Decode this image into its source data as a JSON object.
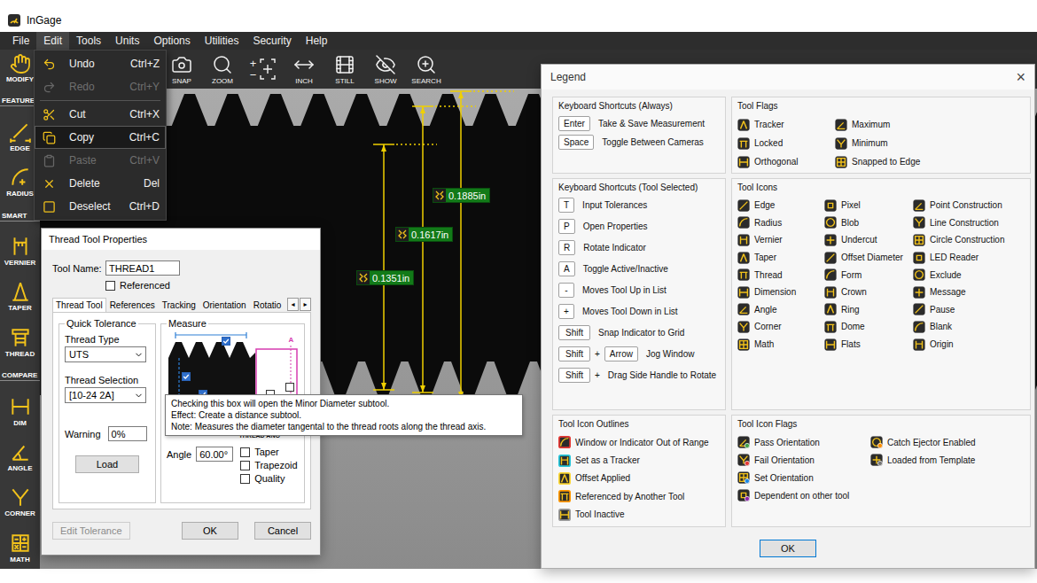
{
  "window": {
    "title": "InGage"
  },
  "menu_bar": [
    {
      "label": "File",
      "selected": false
    },
    {
      "label": "Edit",
      "selected": true
    },
    {
      "label": "Tools",
      "selected": false
    },
    {
      "label": "Units",
      "selected": false
    },
    {
      "label": "Options",
      "selected": false
    },
    {
      "label": "Utilities",
      "selected": false
    },
    {
      "label": "Security",
      "selected": false
    },
    {
      "label": "Help",
      "selected": false
    }
  ],
  "toolbar": [
    {
      "kind": "button",
      "label": "SNAP"
    },
    {
      "kind": "button",
      "label": "ZOOM"
    },
    {
      "kind": "zoom-steps",
      "symbols": [
        "+",
        "−"
      ]
    },
    {
      "kind": "button",
      "label": "INCH"
    },
    {
      "kind": "button",
      "label": "STILL"
    },
    {
      "kind": "button",
      "label": "SHOW"
    },
    {
      "kind": "button",
      "label": "SEARCH"
    }
  ],
  "sidebar": [
    {
      "kind": "tool",
      "label": "MODIFY"
    },
    {
      "kind": "section",
      "label": "FEATURE"
    },
    {
      "kind": "tool",
      "label": "EDGE"
    },
    {
      "kind": "tool",
      "label": "RADIUS"
    },
    {
      "kind": "section",
      "label": "SMART"
    },
    {
      "kind": "tool",
      "label": "VERNIER"
    },
    {
      "kind": "tool",
      "label": "TAPER"
    },
    {
      "kind": "tool",
      "label": "THREAD"
    },
    {
      "kind": "section",
      "label": "COMPARE"
    },
    {
      "kind": "tool",
      "label": "DIM"
    },
    {
      "kind": "tool",
      "label": "ANGLE"
    },
    {
      "kind": "tool",
      "label": "CORNER"
    },
    {
      "kind": "tool",
      "label": "MATH"
    }
  ],
  "camera": {
    "measurements": [
      {
        "value": "0.1885in"
      },
      {
        "value": "0.1617in"
      },
      {
        "value": "0.1351in"
      }
    ]
  },
  "edit_menu": [
    {
      "label": "Undo",
      "shortcut": "Ctrl+Z",
      "disabled": false,
      "selected": false,
      "divider_before": false
    },
    {
      "label": "Redo",
      "shortcut": "Ctrl+Y",
      "disabled": true,
      "selected": false,
      "divider_before": false
    },
    {
      "label": "Cut",
      "shortcut": "Ctrl+X",
      "disabled": false,
      "selected": false,
      "divider_before": true
    },
    {
      "label": "Copy",
      "shortcut": "Ctrl+C",
      "disabled": false,
      "selected": true,
      "divider_before": false
    },
    {
      "label": "Paste",
      "shortcut": "Ctrl+V",
      "disabled": true,
      "selected": false,
      "divider_before": false
    },
    {
      "label": "Delete",
      "shortcut": "Del",
      "disabled": false,
      "selected": false,
      "divider_before": false
    },
    {
      "label": "Deselect",
      "shortcut": "Ctrl+D",
      "disabled": false,
      "selected": false,
      "divider_before": false
    }
  ],
  "thread_dialog": {
    "title": "Thread Tool Properties",
    "tool_name_label": "Tool Name:",
    "tool_name": "THREAD1",
    "referenced": {
      "label": "Referenced",
      "checked": false
    },
    "tabs": [
      {
        "label": "Thread Tool",
        "selected": true
      },
      {
        "label": "References",
        "selected": false
      },
      {
        "label": "Tracking",
        "selected": false
      },
      {
        "label": "Orientation",
        "selected": false
      },
      {
        "label": "Rotatio",
        "selected": false
      }
    ],
    "tab_scroll": [
      "◂",
      "▸"
    ],
    "quick_tolerance": {
      "title": "Quick Tolerance",
      "thread_type_label": "Thread Type",
      "thread_type": "UTS",
      "thread_selection_label": "Thread Selection",
      "thread_selection": "[10-24 2A]",
      "warning_label": "Warning",
      "warning": "0%",
      "load": "Load"
    },
    "measure": {
      "title": "Measure",
      "diagram_labels": [
        "A",
        "A",
        "THREAD ANG"
      ],
      "subtools": [
        {
          "checked": true
        },
        {
          "checked": true
        },
        {
          "checked": true
        },
        {
          "checked": false
        },
        {
          "checked": false
        }
      ],
      "angle_label": "Angle",
      "angle": "60.00°",
      "options": [
        {
          "label": "Taper",
          "checked": false
        },
        {
          "label": "Trapezoid",
          "checked": false
        },
        {
          "label": "Quality",
          "checked": false
        }
      ]
    },
    "buttons": [
      {
        "label": "Edit Tolerance",
        "disabled": true
      },
      {
        "label": "OK",
        "disabled": false
      },
      {
        "label": "Cancel",
        "disabled": false
      }
    ]
  },
  "tooltip": {
    "lines": [
      "Checking this box will open the Minor Diameter subtool.",
      "Effect: Create a distance subtool.",
      "Note: Measures the diameter tangental to the thread roots along the thread axis."
    ]
  },
  "legend": {
    "title": "Legend",
    "close": "×",
    "shortcuts_always": {
      "title": "Keyboard Shortcuts (Always)",
      "rows": [
        {
          "keys": [
            {
              "kind": "key",
              "label": "Enter"
            }
          ],
          "description": "Take & Save Measurement"
        },
        {
          "keys": [
            {
              "kind": "key",
              "label": "Space"
            }
          ],
          "description": "Toggle Between Cameras"
        }
      ]
    },
    "shortcuts_tool": {
      "title": "Keyboard Shortcuts (Tool Selected)",
      "rows": [
        {
          "keys": [
            {
              "kind": "key",
              "label": "T"
            }
          ],
          "description": "Input Tolerances"
        },
        {
          "keys": [
            {
              "kind": "key",
              "label": "P"
            }
          ],
          "description": "Open Properties"
        },
        {
          "keys": [
            {
              "kind": "key",
              "label": "R"
            }
          ],
          "description": "Rotate Indicator"
        },
        {
          "keys": [
            {
              "kind": "key",
              "label": "A"
            }
          ],
          "description": "Toggle Active/Inactive"
        },
        {
          "keys": [
            {
              "kind": "key",
              "label": "-"
            }
          ],
          "description": "Moves Tool Up in List"
        },
        {
          "keys": [
            {
              "kind": "key",
              "label": "+"
            }
          ],
          "description": "Moves Tool Down in List"
        },
        {
          "keys": [
            {
              "kind": "key",
              "label": "Shift"
            }
          ],
          "description": "Snap Indicator to Grid"
        },
        {
          "keys": [
            {
              "kind": "key",
              "label": "Shift"
            },
            {
              "kind": "plus",
              "label": "+"
            },
            {
              "kind": "key",
              "label": "Arrow"
            }
          ],
          "description": "Jog Window"
        },
        {
          "keys": [
            {
              "kind": "key",
              "label": "Shift"
            },
            {
              "kind": "plus",
              "label": "+"
            }
          ],
          "description": "Drag Side Handle to Rotate"
        }
      ]
    },
    "tool_flags": {
      "title": "Tool Flags",
      "items": [
        {
          "label": "Tracker"
        },
        {
          "label": "Locked"
        },
        {
          "label": "Orthogonal"
        },
        {
          "label": "Maximum"
        },
        {
          "label": "Minimum"
        },
        {
          "label": "Snapped to Edge"
        }
      ]
    },
    "tool_icons": {
      "title": "Tool Icons",
      "items": [
        {
          "label": "Edge"
        },
        {
          "label": "Radius"
        },
        {
          "label": "Vernier"
        },
        {
          "label": "Taper"
        },
        {
          "label": "Thread"
        },
        {
          "label": "Dimension"
        },
        {
          "label": "Angle"
        },
        {
          "label": "Corner"
        },
        {
          "label": "Math"
        },
        {
          "label": "Pixel"
        },
        {
          "label": "Blob"
        },
        {
          "label": "Undercut"
        },
        {
          "label": "Offset Diameter"
        },
        {
          "label": "Form"
        },
        {
          "label": "Crown"
        },
        {
          "label": "Ring"
        },
        {
          "label": "Dome"
        },
        {
          "label": "Flats"
        },
        {
          "label": "Point Construction"
        },
        {
          "label": "Line Construction"
        },
        {
          "label": "Circle Construction"
        },
        {
          "label": "LED Reader"
        },
        {
          "label": "Exclude"
        },
        {
          "label": "Message"
        },
        {
          "label": "Pause"
        },
        {
          "label": "Blank"
        },
        {
          "label": "Origin"
        }
      ]
    },
    "icon_outlines": {
      "title": "Tool Icon Outlines",
      "items": [
        {
          "label": "Window or Indicator Out of Range",
          "color": "#e53935"
        },
        {
          "label": "Set as a Tracker",
          "color": "#26c6da"
        },
        {
          "label": "Offset Applied",
          "color": "#fdd835"
        },
        {
          "label": "Referenced by Another Tool",
          "color": "#ff9800"
        },
        {
          "label": "Tool Inactive",
          "color": "#9e9e9e"
        }
      ]
    },
    "icon_flags": {
      "title": "Tool Icon Flags",
      "items": [
        {
          "label": "Pass Orientation",
          "color": "#43a047"
        },
        {
          "label": "Fail Orientation",
          "color": "#e53935"
        },
        {
          "label": "Set Orientation",
          "color": "#1e88e5"
        },
        {
          "label": "Dependent on other tool",
          "color": "#8e24aa"
        },
        {
          "label": "Catch Ejector Enabled",
          "color": "#fb8c00"
        },
        {
          "label": "Loaded from Template",
          "color": "#757575"
        }
      ]
    },
    "ok": "OK"
  }
}
